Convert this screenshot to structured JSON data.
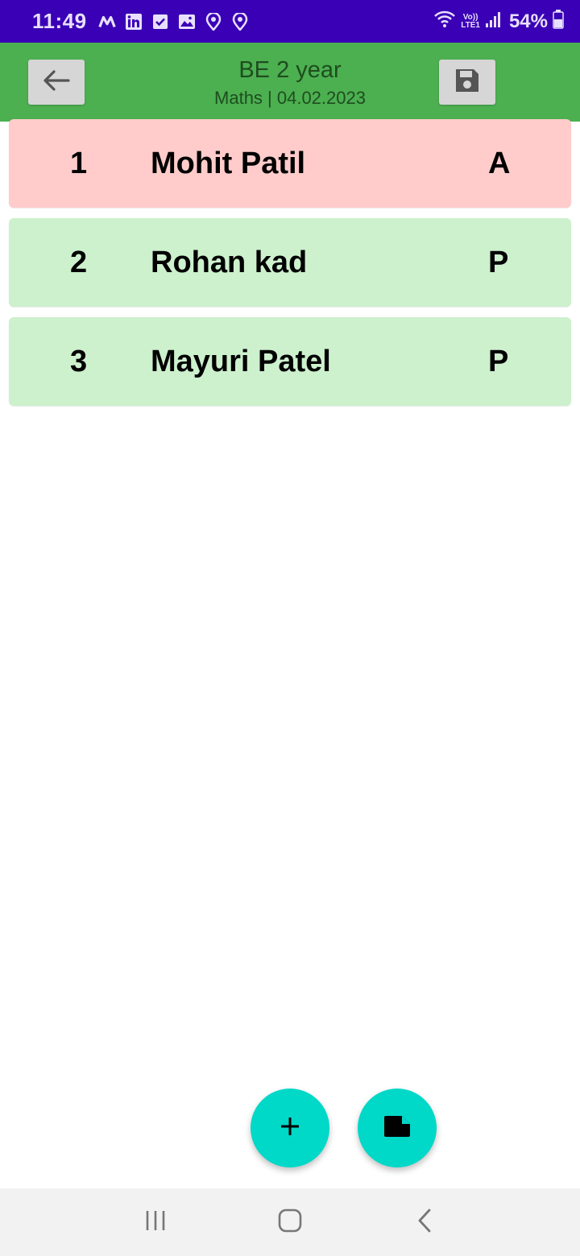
{
  "status_bar": {
    "time": "11:49",
    "battery_percent": "54%",
    "volte_top": "Vo))",
    "volte_bottom": "LTE1",
    "icons_left": [
      "myntra-icon",
      "linkedin-icon",
      "checkbox-icon",
      "gallery-icon",
      "location-icon",
      "location-icon"
    ],
    "icons_right": [
      "wifi-icon",
      "volte-icon",
      "signal-icon",
      "battery-icon"
    ]
  },
  "app_bar": {
    "title": "BE 2 year",
    "subtitle": "Maths | 04.02.2023",
    "back_icon": "arrow-left-icon",
    "save_icon": "floppy-disk-icon"
  },
  "students": [
    {
      "number": "1",
      "name": "Mohit Patil",
      "status": "A",
      "state": "absent"
    },
    {
      "number": "2",
      "name": "Rohan kad",
      "status": "P",
      "state": "present"
    },
    {
      "number": "3",
      "name": "Mayuri Patel",
      "status": "P",
      "state": "present"
    }
  ],
  "fabs": {
    "add_icon": "plus-icon",
    "note_icon": "note-icon"
  },
  "colors": {
    "status_bar": "#3a00b5",
    "app_bar": "#4caf50",
    "absent": "#ffcccb",
    "present": "#cdf0cd",
    "fab": "#00d8c8"
  },
  "nav": {
    "recents_icon": "recents-icon",
    "home_icon": "home-icon",
    "back_icon": "back-chevron-icon"
  }
}
